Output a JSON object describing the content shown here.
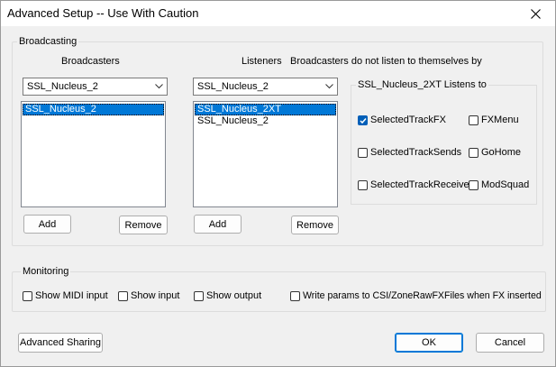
{
  "window": {
    "title": "Advanced Setup -- Use With Caution"
  },
  "broadcasting": {
    "group_label": "Broadcasting",
    "broadcasters_label": "Broadcasters",
    "broadcasters_selected": "SSL_Nucleus_2",
    "broadcasters_list": [
      "SSL_Nucleus_2"
    ],
    "add_label": "Add",
    "remove_label": "Remove",
    "listeners_label": "Listeners",
    "listeners_selected": "SSL_Nucleus_2",
    "listeners_list": [
      "SSL_Nucleus_2XT",
      "SSL_Nucleus_2"
    ],
    "listeners_add_label": "Add",
    "listeners_remove_label": "Remove",
    "note": "Broadcasters do not listen to themselves by",
    "listens_to_label": "SSL_Nucleus_2XT Listens to",
    "options": [
      {
        "label": "SelectedTrackFX",
        "checked": true
      },
      {
        "label": "FXMenu",
        "checked": false
      },
      {
        "label": "SelectedTrackSends",
        "checked": false
      },
      {
        "label": "GoHome",
        "checked": false
      },
      {
        "label": "SelectedTrackReceives",
        "checked": false
      },
      {
        "label": "ModSquad",
        "checked": false
      }
    ]
  },
  "monitoring": {
    "group_label": "Monitoring",
    "options": [
      {
        "label": "Show MIDI input",
        "checked": false
      },
      {
        "label": "Show input",
        "checked": false
      },
      {
        "label": "Show output",
        "checked": false
      },
      {
        "label": "Write params to CSI/ZoneRawFXFiles when FX inserted",
        "checked": false
      }
    ]
  },
  "footer": {
    "advanced_sharing_label": "Advanced Sharing",
    "ok_label": "OK",
    "cancel_label": "Cancel"
  },
  "colors": {
    "selection": "#0078d7",
    "checkbox_checked": "#005fb8",
    "dialog_bg": "#f0f0f0"
  }
}
